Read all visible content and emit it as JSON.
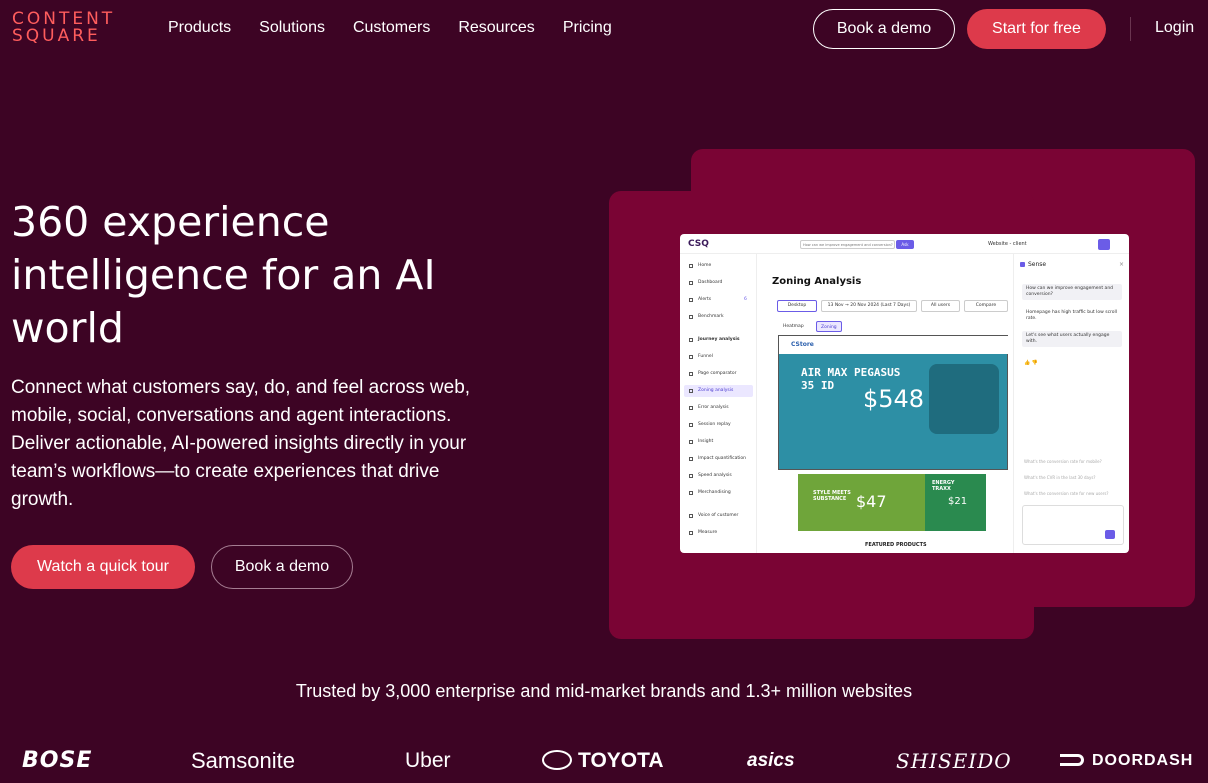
{
  "header": {
    "logo_line1": "CONTENT",
    "logo_line2": "SQUARE",
    "nav": [
      "Products",
      "Solutions",
      "Customers",
      "Resources",
      "Pricing"
    ],
    "book_demo": "Book a demo",
    "start_free": "Start for free",
    "login": "Login"
  },
  "hero": {
    "title": "360 experience intelligence for an AI world",
    "subtitle": "Connect what customers say, do, and feel across web, mobile, social, conversations and agent interactions. Deliver actionable, AI-powered insights directly in your team’s workflows—to create experiences that drive growth.",
    "cta_tour": "Watch a quick tour",
    "cta_demo": "Book a demo"
  },
  "app": {
    "logo": "CSQ",
    "ask_placeholder": "How can we improve engagement and conversion?",
    "ask_button": "Ask",
    "site_selector": "Website - client",
    "sidebar": [
      "Home",
      "Dashboard",
      "Alerts",
      "Benchmark",
      "Journey analysis",
      "Funnel",
      "Page comparator",
      "Zoning analysis",
      "Error analysis",
      "Session replay",
      "Insight",
      "Impact quantification",
      "Speed analysis",
      "Merchandising",
      "Voice of customer",
      "Measure"
    ],
    "alerts_count": "6",
    "main_title": "Zoning Analysis",
    "filters": {
      "device": "Desktop",
      "date": "13 Nov → 20 Nov 2024 (Last 7 Days)",
      "users": "All users",
      "compare": "Compare"
    },
    "toggles": {
      "heatmap": "Heatmap",
      "zoning": "Zoning"
    },
    "preview": {
      "store": "CStore",
      "headline": "AIR MAX PEGASUS 35 ID",
      "price_main": "$548",
      "promo_text": "STYLE MEETS SUBSTANCE",
      "price_promo": "$47",
      "promo2_text": "ENERGY TRAXX",
      "price_promo2": "$21",
      "featured": "FEATURED PRODUCTS"
    },
    "sense": {
      "title": "Sense",
      "q1": "How can we improve engagement and conversion?",
      "a1": "Homepage has high traffic but low scroll rate.",
      "a2": "Let's see what users actually engage with.",
      "suggestions": [
        "What's the conversion rate for mobile?",
        "What's the CVR in the last 30 days?",
        "What's the conversion rate for new users?"
      ]
    }
  },
  "trusted": "Trusted by 3,000 enterprise and mid-market brands and 1.3+ million websites",
  "brands": [
    "BOSE",
    "Samsonite",
    "Uber",
    "TOYOTA",
    "asics",
    "SHISEIDO",
    "DOORDASH"
  ],
  "colors": {
    "background": "#3d0424",
    "accent": "#dd3a4b",
    "logo": "#ff5d5d",
    "panel": "#7a0434",
    "app_accent": "#6b5ce7"
  }
}
